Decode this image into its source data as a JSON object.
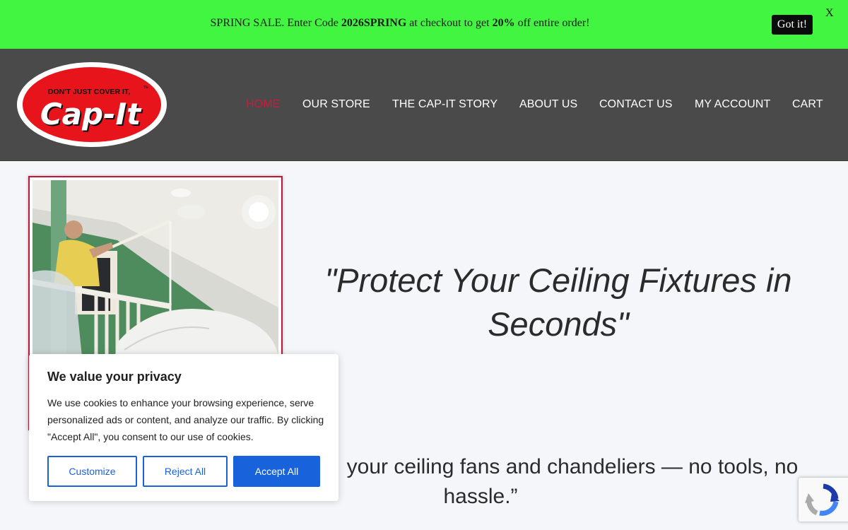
{
  "promo": {
    "text_before": "SPRING SALE. Enter Code ",
    "code": "2026SPRING",
    "text_middle": " at checkout to get ",
    "discount": "20%",
    "text_after": " off entire order!",
    "got_it_label": "Got it!",
    "close_label": "X",
    "background_color": "#42f540"
  },
  "logo": {
    "tagline": "DON'T JUST COVER IT,",
    "tm": "TM",
    "name": "Cap-It",
    "red": "#e8141b"
  },
  "nav": {
    "items": [
      {
        "label": "HOME",
        "active": true
      },
      {
        "label": "OUR STORE"
      },
      {
        "label": "THE CAP-IT STORY"
      },
      {
        "label": "ABOUT US"
      },
      {
        "label": "CONTACT US"
      },
      {
        "label": "MY ACCOUNT"
      },
      {
        "label": "CART"
      }
    ],
    "active_color": "#d2163c"
  },
  "hero": {
    "quote_line1": "\"Protect Your Ceiling Fixtures in",
    "quote_line2": "Seconds\"",
    "sub_line1": "your ceiling fans and chandeliers — no tools, no",
    "sub_line2": "hassle.”"
  },
  "cookie": {
    "title": "We value your privacy",
    "body": "We use cookies to enhance your browsing experience, serve personalized ads or content, and analyze our traffic. By clicking \"Accept All\", you consent to our use of cookies.",
    "customize_label": "Customize",
    "reject_label": "Reject All",
    "accept_label": "Accept All",
    "accent": "#1863dc"
  },
  "recaptcha": {
    "icon": "recaptcha-icon"
  }
}
